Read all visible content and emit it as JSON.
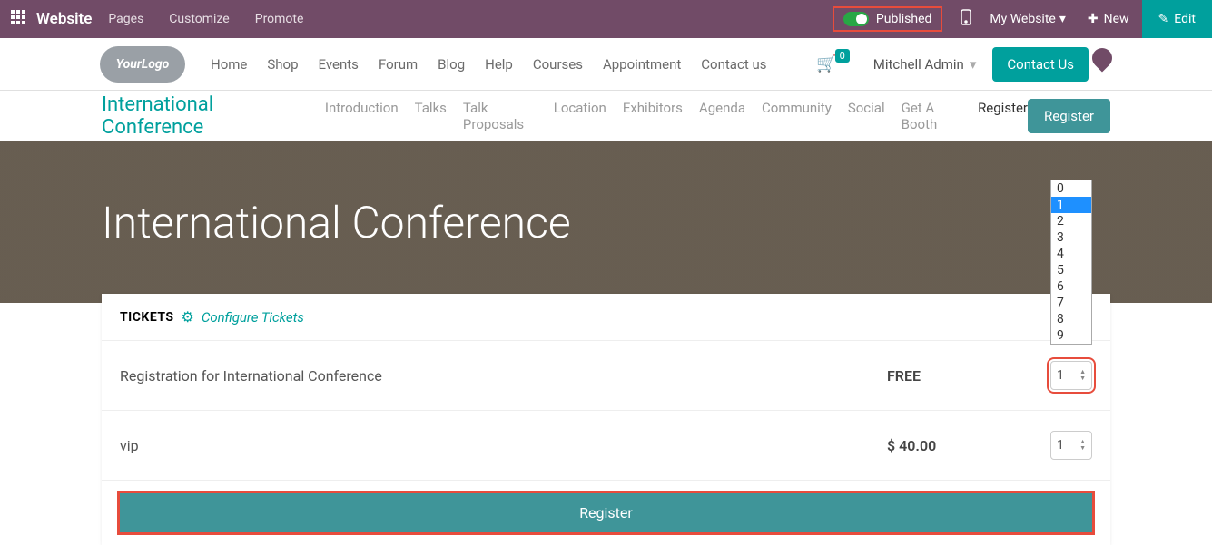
{
  "topbar": {
    "brand": "Website",
    "tabs": [
      "Pages",
      "Customize",
      "Promote"
    ],
    "published": "Published",
    "my_website": "My Website",
    "new": "New",
    "edit": "Edit"
  },
  "navbar": {
    "logo": "YourLogo",
    "menu": [
      "Home",
      "Shop",
      "Events",
      "Forum",
      "Blog",
      "Help",
      "Courses",
      "Appointment",
      "Contact us"
    ],
    "cart_count": "0",
    "user": "Mitchell Admin",
    "contact": "Contact Us"
  },
  "subnav": {
    "title": "International Conference",
    "links": [
      "Introduction",
      "Talks",
      "Talk Proposals",
      "Location",
      "Exhibitors",
      "Agenda",
      "Community",
      "Social",
      "Get A Booth",
      "Register"
    ],
    "active": "Register",
    "button": "Register"
  },
  "hero": {
    "title": "International Conference"
  },
  "tickets": {
    "header": "TICKETS",
    "configure": "Configure Tickets",
    "rows": [
      {
        "name": "Registration for International Conference",
        "price": "FREE",
        "qty": "1"
      },
      {
        "name": "vip",
        "price": "$ 40.00",
        "qty": "1"
      }
    ],
    "register": "Register"
  },
  "dropdown_options": [
    "0",
    "1",
    "2",
    "3",
    "4",
    "5",
    "6",
    "7",
    "8",
    "9"
  ],
  "dropdown_selected": "1"
}
